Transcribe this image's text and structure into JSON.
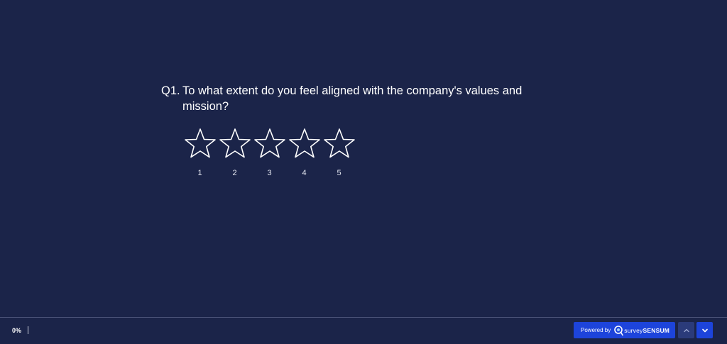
{
  "question": {
    "number": "Q1.",
    "text": "To what extent do you feel aligned with the company's values and mission?"
  },
  "rating": {
    "type": "stars",
    "selected": 0,
    "options": [
      {
        "label": "1"
      },
      {
        "label": "2"
      },
      {
        "label": "3"
      },
      {
        "label": "4"
      },
      {
        "label": "5"
      }
    ]
  },
  "footer": {
    "progress_text": "0%",
    "progress_value": 0,
    "powered_by_label": "Powered by",
    "brand_survey": "survey",
    "brand_sensum": "SENSUM",
    "up_icon": "chevron-up-icon",
    "down_icon": "chevron-down-icon"
  },
  "colors": {
    "background": "#1b2449",
    "accent": "#1d44db",
    "nav_up": "#2b3b7a",
    "text": "#ffffff"
  }
}
